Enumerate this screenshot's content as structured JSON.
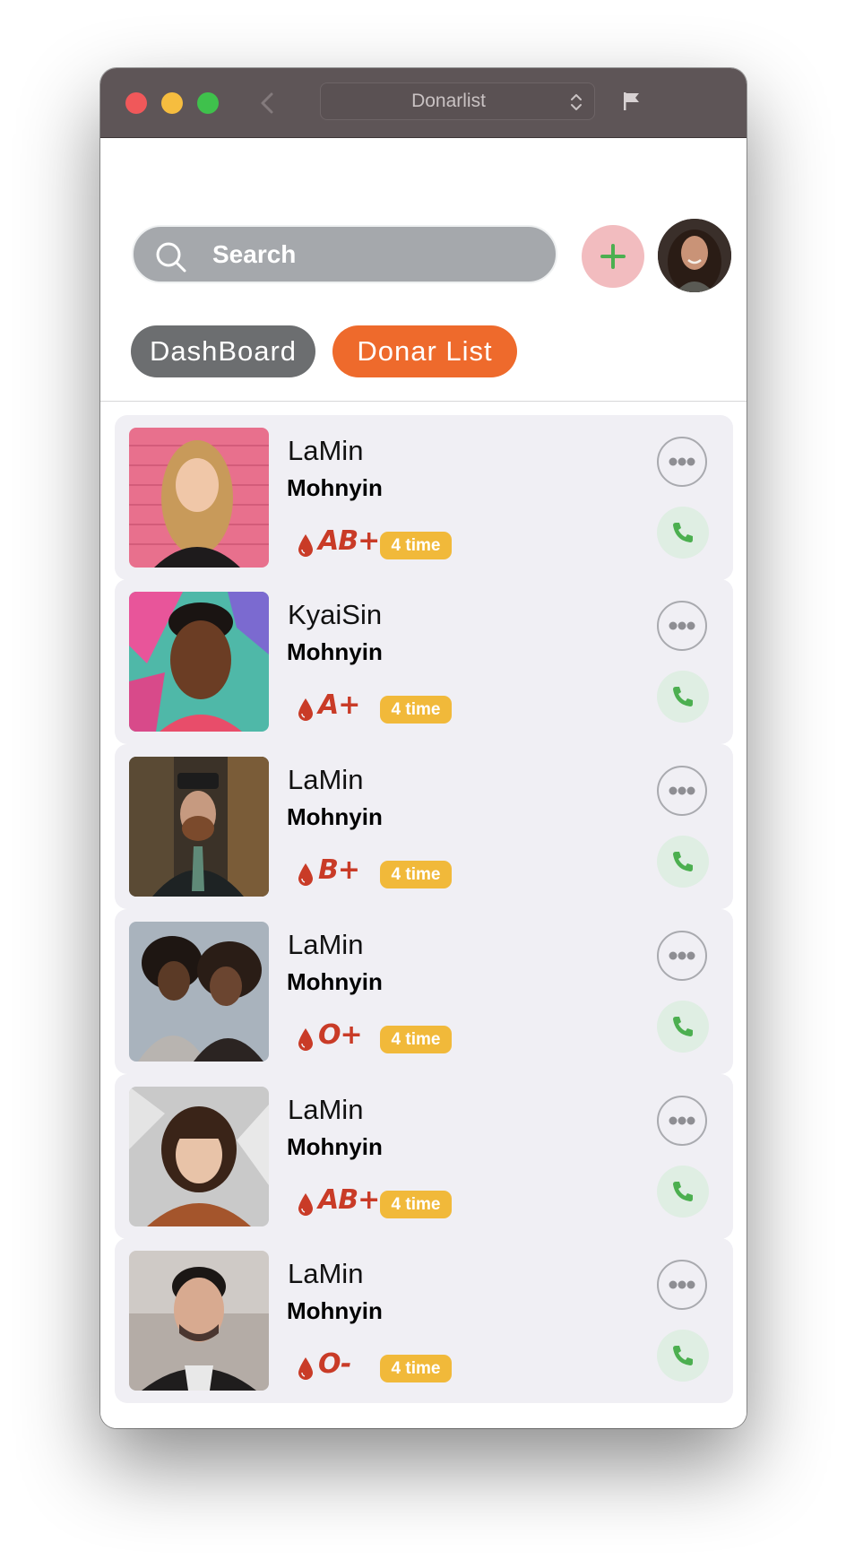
{
  "window": {
    "title": "Donarlist"
  },
  "header": {
    "search_placeholder": "Search",
    "tabs": [
      {
        "label": "DashBoard",
        "active": false
      },
      {
        "label": "Donar List",
        "active": true
      }
    ]
  },
  "colors": {
    "accent": "#ee6a2c",
    "blood_text": "#c93b27",
    "badge": "#f1b93a",
    "call_icon": "#4caf50",
    "card_bg": "#f0eff4"
  },
  "icons": {
    "search": "search-icon",
    "add": "plus-icon",
    "more": "more-icon",
    "call": "phone-icon",
    "blood": "blood-drop-icon"
  },
  "donors": [
    {
      "name": "LaMin",
      "location": "Mohnyin",
      "blood_type": "AB+",
      "times": "4 time"
    },
    {
      "name": "KyaiSin",
      "location": "Mohnyin",
      "blood_type": "A+",
      "times": "4 time"
    },
    {
      "name": "LaMin",
      "location": "Mohnyin",
      "blood_type": "B+",
      "times": "4 time"
    },
    {
      "name": "LaMin",
      "location": "Mohnyin",
      "blood_type": "O+",
      "times": "4 time"
    },
    {
      "name": "LaMin",
      "location": "Mohnyin",
      "blood_type": "AB+",
      "times": "4 time"
    },
    {
      "name": "LaMin",
      "location": "Mohnyin",
      "blood_type": "O-",
      "times": "4 time"
    }
  ]
}
